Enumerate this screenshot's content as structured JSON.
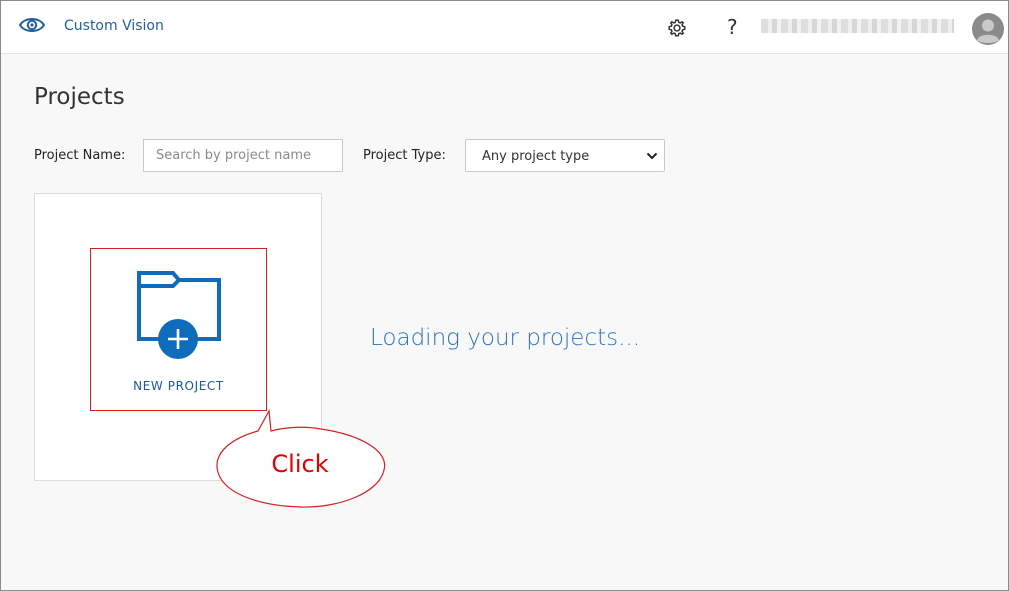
{
  "header": {
    "brand_title": "Custom Vision",
    "brand_icon": "eye-icon",
    "settings_icon": "gear-icon",
    "help_label": "?",
    "user_name": "",
    "avatar_icon": "user-avatar-icon"
  },
  "main": {
    "title": "Projects",
    "filters": {
      "name_label": "Project Name:",
      "name_placeholder": "Search by project name",
      "name_value": "",
      "type_label": "Project Type:",
      "type_selected": "Any project type"
    },
    "new_project": {
      "label": "NEW PROJECT",
      "icon": "folder-plus-icon"
    },
    "loading_text": "Loading your projects..."
  },
  "annotation": {
    "callout_text": "Click"
  },
  "colors": {
    "accent": "#0f6cbd",
    "brand_text": "#1f5f9e",
    "loading_text": "#2e73b8",
    "annotation_red": "#d31f1f"
  }
}
